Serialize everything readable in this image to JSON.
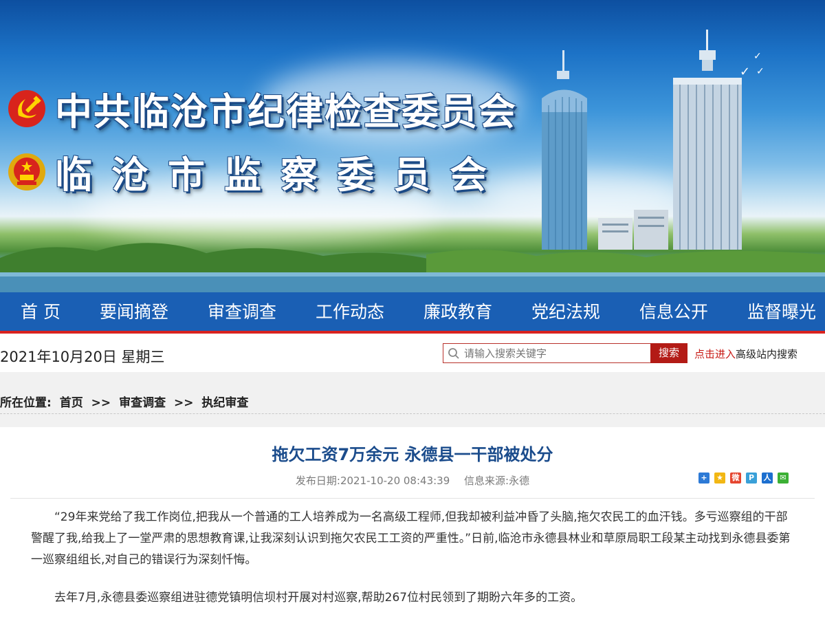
{
  "banner": {
    "title_line1": "中共临沧市纪律检查委员会",
    "title_line2": "临沧市监察委员会"
  },
  "nav": {
    "items": [
      "首 页",
      "要闻摘登",
      "审查调查",
      "工作动态",
      "廉政教育",
      "党纪法规",
      "信息公开",
      "监督曝光"
    ]
  },
  "infobar": {
    "date": "2021年10月20日 星期三",
    "search_placeholder": "请输入搜索关键字",
    "search_button": "搜索",
    "adv_link": "点击进入",
    "adv_text": "高级站内搜索"
  },
  "breadcrumb": {
    "label": "所在位置:",
    "items": [
      "首页",
      ">>",
      "审查调查",
      ">>",
      "执纪审查"
    ]
  },
  "article": {
    "title": "拖欠工资7万余元 永德县一干部被处分",
    "publish_date": "发布日期:2021-10-20 08:43:39",
    "source": "信息来源:永德",
    "share_icons": [
      "share-more-icon",
      "share-qzone-icon",
      "share-weibo-icon",
      "share-tencent-weibo-icon",
      "share-renren-icon",
      "share-wechat-icon"
    ],
    "paragraphs": [
      "“29年来党给了我工作岗位,把我从一个普通的工人培养成为一名高级工程师,但我却被利益冲昏了头脑,拖欠农民工的血汗钱。多亏巡察组的干部警醒了我,给我上了一堂严肃的思想教育课,让我深刻认识到拖欠农民工工资的严重性。”日前,临沧市永德县林业和草原局职工段某主动找到永德县委第一巡察组组长,对自己的错误行为深刻忏悔。",
      "去年7月,永德县委巡察组进驻德党镇明信坝村开展对村巡察,帮助267位村民领到了期盼六年多的工资。"
    ]
  },
  "colors": {
    "nav_bg": "#1a5fb4",
    "accent_red": "#c81b16",
    "title_blue": "#1b4c8c"
  }
}
